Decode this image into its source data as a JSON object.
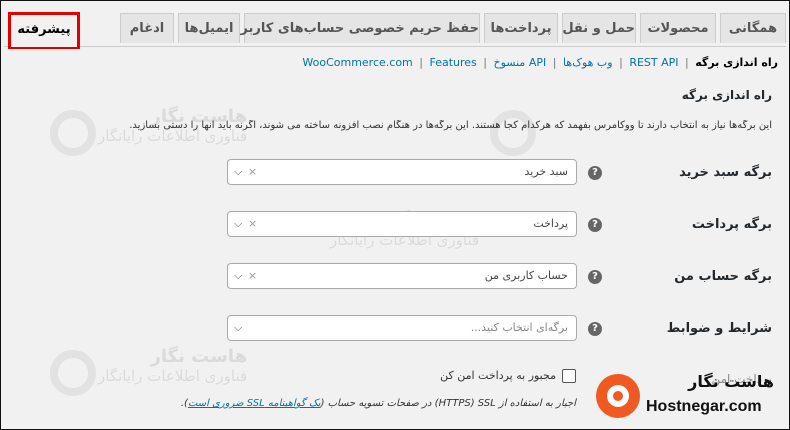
{
  "tabs": [
    {
      "label": "همگانی",
      "active": false
    },
    {
      "label": "محصولات",
      "active": false
    },
    {
      "label": "حمل و نقل",
      "active": false
    },
    {
      "label": "پرداخت‌ها",
      "active": false
    },
    {
      "label": "حفظ حریم خصوصی حساب‌های کاربری",
      "active": false
    },
    {
      "label": "ایمیل‌ها",
      "active": false
    },
    {
      "label": "ادغام",
      "active": false
    },
    {
      "label": "پیشرفته",
      "active": true
    }
  ],
  "subnav": {
    "current": "راه اندازی برگه",
    "links": [
      "REST API",
      "وب هوک‌ها",
      "API منسوخ",
      "WooCommerce.com",
      "Features"
    ]
  },
  "section": {
    "title": "راه اندازی برگه",
    "description": "این برگه‌ها نیاز به انتخاب دارند تا ووکامرس بفهمد که هرکدام کجا هستند. این برگه‌ها در هنگام نصب افزونه ساخته می شوند، اگرنه باید آنها را دستی بسازید."
  },
  "fields": [
    {
      "label": "برگه سبد خرید",
      "value": "سبد خرید",
      "placeholder": false
    },
    {
      "label": "برگه پرداخت",
      "value": "پرداخت",
      "placeholder": false
    },
    {
      "label": "برگه حساب من",
      "value": "حساب کاربری من",
      "placeholder": false
    },
    {
      "label": "شرایط و ضوابط",
      "value": "برگه‌ای انتخاب کنید...",
      "placeholder": true
    }
  ],
  "secure_checkout": {
    "section_label": "پرداخت امن",
    "checkbox_label": "مجبور به پرداخت امن کن",
    "note_before": "اجبار به استفاده از HTTPS) SSL) در صفحات تسویه حساب (",
    "note_link": "یک گواهینامه SSL ضروری است",
    "note_after": ")."
  },
  "icons": {
    "help": "question-circle-icon",
    "clear": "clear-x-icon",
    "dropdown": "chevron-down-icon"
  },
  "watermark": {
    "title": "هاست نگار",
    "subtitle": "فناوری اطلاعات رایانگار"
  },
  "brand": {
    "name_fa": "هاست نگار",
    "name_en": "Hostnegar.com",
    "color": "#f05a22"
  },
  "colors": {
    "active_tab_outline": "#e00000",
    "link": "#0073aa"
  }
}
